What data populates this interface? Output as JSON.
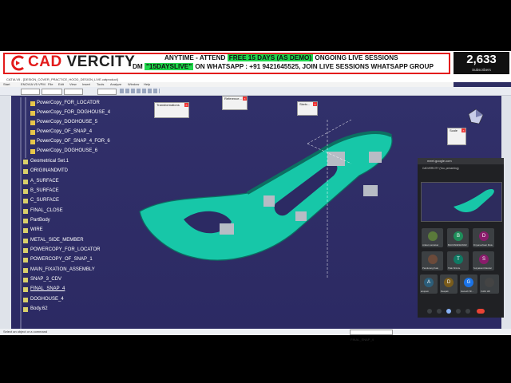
{
  "banner": {
    "brand_prefix": "CAD ",
    "brand_suffix": "VERCITY",
    "line1_pre": "ANYTIME - ATTEND ",
    "line1_hl": "FREE 15 DAYS (AS DEMO)",
    "line1_post": " ONGOING LIVE SESSIONS",
    "line2_pre": "DM ",
    "line2_hl": "\"15DAYSLIVE\"",
    "line2_post": " ON WHATSAPP : +91 9421645525, JOIN LIVE SESSIONS WHATSAPP GROUP",
    "subscriber_count": "2,633",
    "subscriber_label": "Subscribers",
    "colors": {
      "red": "#e31b1b",
      "green": "#1fd64a"
    }
  },
  "window": {
    "title": "CATIA V5 - [DESIGN_COVER_PRACTICE_HOOD_DESIGN_LIVE.catproduct]",
    "menu": [
      "Start",
      "ENOVIA V5 VPM",
      "File",
      "Edit",
      "View",
      "Insert",
      "Tools",
      "Analyze",
      "Window",
      "Help"
    ],
    "toolbar_fields": [
      "None",
      "Auto",
      "None"
    ]
  },
  "tree": [
    {
      "label": "PowerCopy_FOR_LOCATOR"
    },
    {
      "label": "PowerCopy_FOR_DOGHOUSE_4"
    },
    {
      "label": "PowerCopy_DOGHOUSE_5"
    },
    {
      "label": "PowerCopy_OF_SNAP_4"
    },
    {
      "label": "PowerCopy_OF_SNAP_4_FOR_6"
    },
    {
      "label": "PowerCopy_DOGHOUSE_6"
    },
    {
      "label": "Geometrical Set.1"
    },
    {
      "label": "ORIGINANDMTD"
    },
    {
      "label": "A_SURFACE"
    },
    {
      "label": "B_SURFACE"
    },
    {
      "label": "C_SURFACE"
    },
    {
      "label": "FINAL_CLOSE"
    },
    {
      "label": "PartBody"
    },
    {
      "label": "WIRE"
    },
    {
      "label": "METAL_SIDE_MEMBER"
    },
    {
      "label": "POWERCOPY_FOR_LOCATOR"
    },
    {
      "label": "POWERCOPY_OF_SNAP_1"
    },
    {
      "label": "MAIN_FIXATION_ASSEMBLY"
    },
    {
      "label": "SNAP_3_CDV"
    },
    {
      "label": "FINAL_SNAP_4"
    },
    {
      "label": "DOGHOUSE_4"
    },
    {
      "label": "Body.62"
    }
  ],
  "panels": {
    "transformations": "Transformations",
    "reference": "Reference...",
    "sketch": "Sketc...",
    "scale": "Scale"
  },
  "status": {
    "hint": "Select an object or a command",
    "selection": "FINAL_SNAP_4"
  },
  "meet": {
    "url": "meet.google.com",
    "presenting": "CADVERCITY (You, presenting)",
    "participants": [
      {
        "initial": "",
        "name": "Aniket nandekar",
        "color": "#5a7a3a"
      },
      {
        "initial": "B",
        "name": "BHUVANESHWAR",
        "color": "#1e8e5a"
      },
      {
        "initial": "D",
        "name": "Dnyaneshwar Mule",
        "color": "#8a1b6b"
      },
      {
        "initial": "",
        "name": "Pandurang Kale",
        "color": "#6b4a3a"
      },
      {
        "initial": "T",
        "name": "Tilak Shinde",
        "color": "#0f7a64"
      },
      {
        "initial": "S",
        "name": "Suryakant Mandal",
        "color": "#8a1b6b"
      },
      {
        "initial": "A",
        "name": "anupam",
        "color": "#2c5e7a"
      },
      {
        "initial": "D",
        "name": "Deepak",
        "color": "#7a5c1b"
      },
      {
        "initial": "G",
        "name": "Ganesh Sh...",
        "color": "#1a73e8"
      },
      {
        "initial": "",
        "name": "Collin Hill",
        "color": "#444"
      }
    ]
  }
}
